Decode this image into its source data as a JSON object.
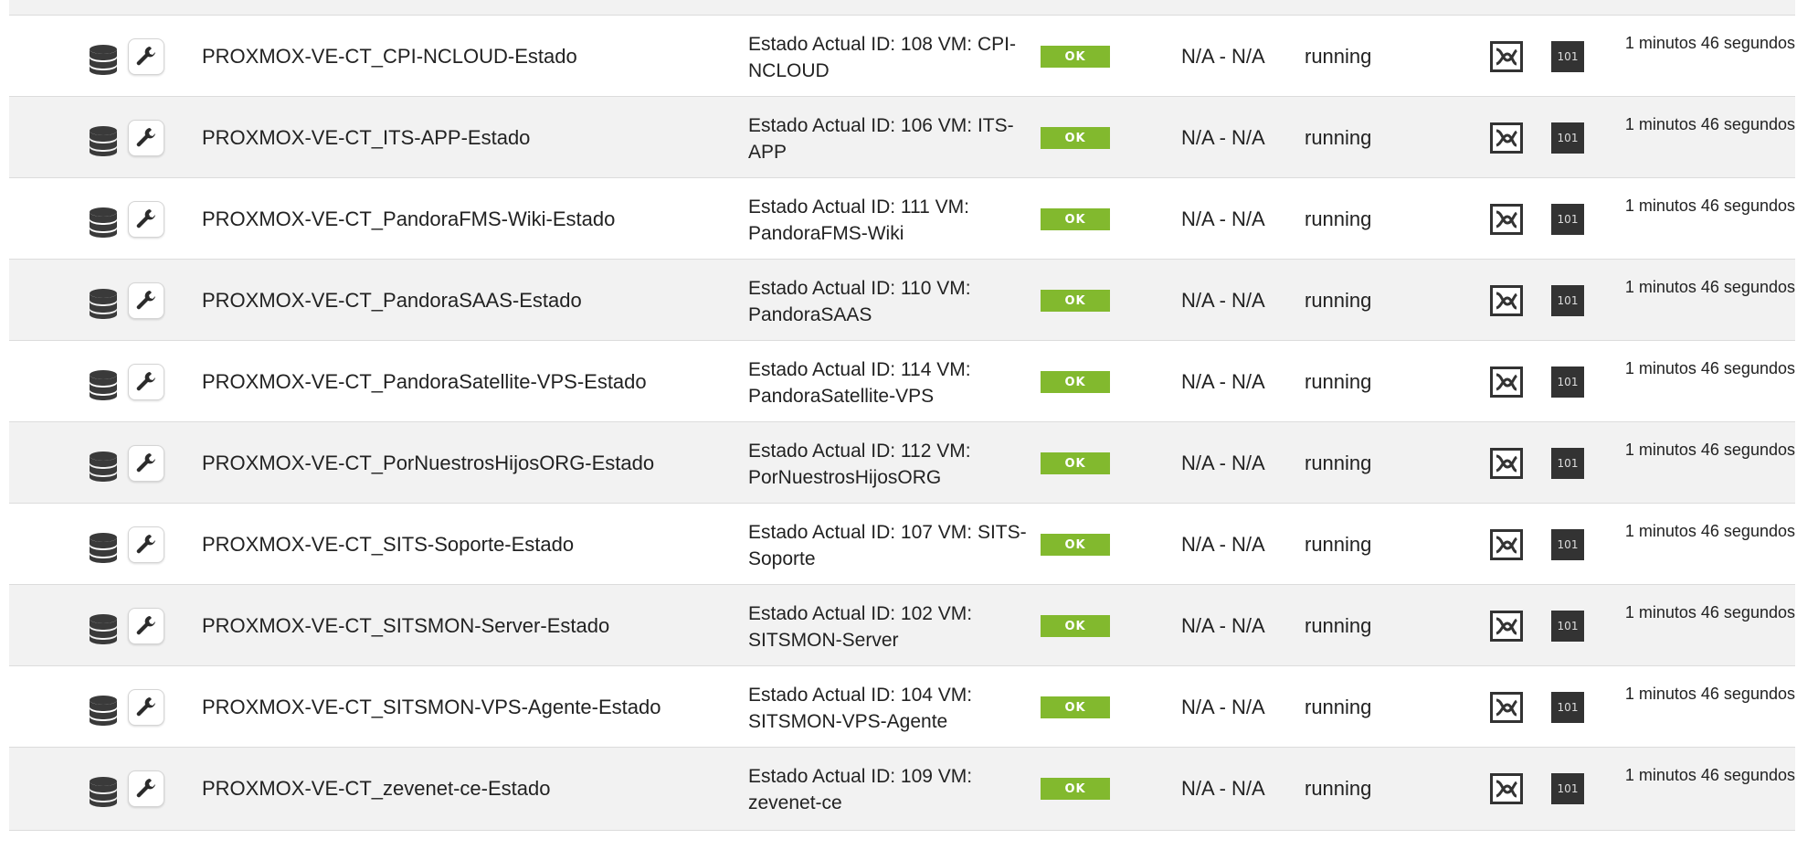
{
  "colors": {
    "ok_badge": "#82b92e",
    "row_alt": "#f2f2f2",
    "raw_icon_bg": "#333333"
  },
  "icons": {
    "type": "database-icon",
    "action": "wrench-icon",
    "graph": "graph-icon",
    "raw_data": "raw-data-icon"
  },
  "rows": [
    {
      "module": "PROXMOX-VE-CT_CPI-NCLOUD-Estado",
      "status_text": "Estado Actual ID: 108 VM: CPI-NCLOUD",
      "status": "OK",
      "thresholds": "N/A - N/A",
      "value": "running",
      "raw_label": "101",
      "last_contact": "1 minutos 46 segundos"
    },
    {
      "module": "PROXMOX-VE-CT_ITS-APP-Estado",
      "status_text": "Estado Actual ID: 106 VM: ITS-APP",
      "status": "OK",
      "thresholds": "N/A - N/A",
      "value": "running",
      "raw_label": "101",
      "last_contact": "1 minutos 46 segundos"
    },
    {
      "module": "PROXMOX-VE-CT_PandoraFMS-Wiki-Estado",
      "status_text": "Estado Actual ID: 111 VM: PandoraFMS-Wiki",
      "status": "OK",
      "thresholds": "N/A - N/A",
      "value": "running",
      "raw_label": "101",
      "last_contact": "1 minutos 46 segundos"
    },
    {
      "module": "PROXMOX-VE-CT_PandoraSAAS-Estado",
      "status_text": "Estado Actual ID: 110 VM: PandoraSAAS",
      "status": "OK",
      "thresholds": "N/A - N/A",
      "value": "running",
      "raw_label": "101",
      "last_contact": "1 minutos 46 segundos"
    },
    {
      "module": "PROXMOX-VE-CT_PandoraSatellite-VPS-Estado",
      "status_text": "Estado Actual ID: 114 VM: PandoraSatellite-VPS",
      "status": "OK",
      "thresholds": "N/A - N/A",
      "value": "running",
      "raw_label": "101",
      "last_contact": "1 minutos 46 segundos"
    },
    {
      "module": "PROXMOX-VE-CT_PorNuestrosHijosORG-Estado",
      "status_text": "Estado Actual ID: 112 VM: PorNuestrosHijosORG",
      "status": "OK",
      "thresholds": "N/A - N/A",
      "value": "running",
      "raw_label": "101",
      "last_contact": "1 minutos 46 segundos"
    },
    {
      "module": "PROXMOX-VE-CT_SITS-Soporte-Estado",
      "status_text": "Estado Actual ID: 107 VM: SITS-Soporte",
      "status": "OK",
      "thresholds": "N/A - N/A",
      "value": "running",
      "raw_label": "101",
      "last_contact": "1 minutos 46 segundos"
    },
    {
      "module": "PROXMOX-VE-CT_SITSMON-Server-Estado",
      "status_text": "Estado Actual ID: 102 VM: SITSMON-Server",
      "status": "OK",
      "thresholds": "N/A - N/A",
      "value": "running",
      "raw_label": "101",
      "last_contact": "1 minutos 46 segundos"
    },
    {
      "module": "PROXMOX-VE-CT_SITSMON-VPS-Agente-Estado",
      "status_text": "Estado Actual ID: 104 VM: SITSMON-VPS-Agente",
      "status": "OK",
      "thresholds": "N/A - N/A",
      "value": "running",
      "raw_label": "101",
      "last_contact": "1 minutos 46 segundos"
    },
    {
      "module": "PROXMOX-VE-CT_zevenet-ce-Estado",
      "status_text": "Estado Actual ID: 109 VM: zevenet-ce",
      "status": "OK",
      "thresholds": "N/A - N/A",
      "value": "running",
      "raw_label": "101",
      "last_contact": "1 minutos 46 segundos"
    }
  ]
}
